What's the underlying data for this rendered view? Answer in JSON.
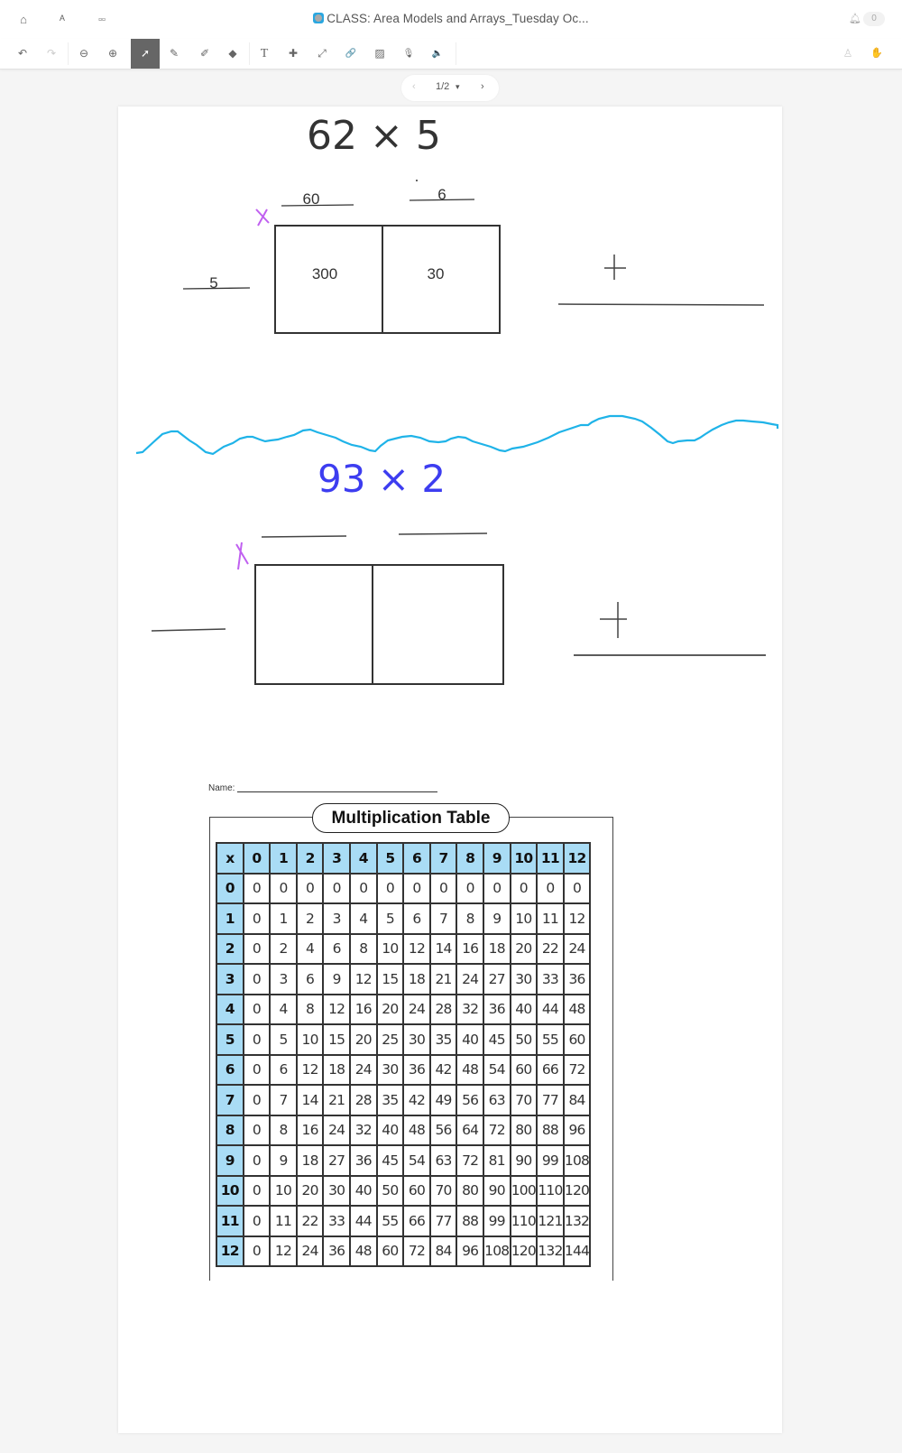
{
  "header": {
    "title": "CLASS: Area Models and Arrays_Tuesday Oc...",
    "notification_count": "0",
    "nav_icons": [
      "home-icon",
      "profile-icon",
      "apps-grid-icon"
    ]
  },
  "toolbar": {
    "undo": "↶",
    "redo": "↷",
    "zoom_out": "⊖",
    "zoom_in": "⊕",
    "select": "➚",
    "pen": "✎",
    "highlighter": "✐",
    "eraser": "◆",
    "text": "T",
    "add": "✚",
    "line": "⤢",
    "link": "🔗",
    "image": "▨",
    "mic": "🎙",
    "audio": "🔈",
    "user": "♙",
    "hand": "✋"
  },
  "pager": {
    "prev": "‹",
    "current": "1/2",
    "dropdown": "▾",
    "next": "›"
  },
  "canvas": {
    "problem1": {
      "expression": "62 × 5",
      "top_labels": [
        "60",
        "6"
      ],
      "side_label": "5",
      "cells": [
        "300",
        "30"
      ],
      "plus": "+",
      "x_mark": "X"
    },
    "problem2": {
      "expression": "93 × 2",
      "top_labels": [
        "",
        ""
      ],
      "side_label": "",
      "cells": [
        "",
        ""
      ],
      "plus": "+",
      "x_mark": "X"
    },
    "colors": {
      "ink": "#222222",
      "marker_purple": "#c060f0",
      "divider_cyan": "#1fb3e8",
      "problem2_ink": "#3d3df0"
    }
  },
  "worksheet": {
    "name_label": "Name:",
    "title": "Multiplication Table",
    "corner": "x",
    "header_color": "#a9dcf5",
    "columns": [
      "0",
      "1",
      "2",
      "3",
      "4",
      "5",
      "6",
      "7",
      "8",
      "9",
      "10",
      "11",
      "12"
    ],
    "rows": [
      {
        "h": "0",
        "v": [
          "0",
          "0",
          "0",
          "0",
          "0",
          "0",
          "0",
          "0",
          "0",
          "0",
          "0",
          "0",
          "0"
        ]
      },
      {
        "h": "1",
        "v": [
          "0",
          "1",
          "2",
          "3",
          "4",
          "5",
          "6",
          "7",
          "8",
          "9",
          "10",
          "11",
          "12"
        ]
      },
      {
        "h": "2",
        "v": [
          "0",
          "2",
          "4",
          "6",
          "8",
          "10",
          "12",
          "14",
          "16",
          "18",
          "20",
          "22",
          "24"
        ]
      },
      {
        "h": "3",
        "v": [
          "0",
          "3",
          "6",
          "9",
          "12",
          "15",
          "18",
          "21",
          "24",
          "27",
          "30",
          "33",
          "36"
        ]
      },
      {
        "h": "4",
        "v": [
          "0",
          "4",
          "8",
          "12",
          "16",
          "20",
          "24",
          "28",
          "32",
          "36",
          "40",
          "44",
          "48"
        ]
      },
      {
        "h": "5",
        "v": [
          "0",
          "5",
          "10",
          "15",
          "20",
          "25",
          "30",
          "35",
          "40",
          "45",
          "50",
          "55",
          "60"
        ]
      },
      {
        "h": "6",
        "v": [
          "0",
          "6",
          "12",
          "18",
          "24",
          "30",
          "36",
          "42",
          "48",
          "54",
          "60",
          "66",
          "72"
        ]
      },
      {
        "h": "7",
        "v": [
          "0",
          "7",
          "14",
          "21",
          "28",
          "35",
          "42",
          "49",
          "56",
          "63",
          "70",
          "77",
          "84"
        ]
      },
      {
        "h": "8",
        "v": [
          "0",
          "8",
          "16",
          "24",
          "32",
          "40",
          "48",
          "56",
          "64",
          "72",
          "80",
          "88",
          "96"
        ]
      },
      {
        "h": "9",
        "v": [
          "0",
          "9",
          "18",
          "27",
          "36",
          "45",
          "54",
          "63",
          "72",
          "81",
          "90",
          "99",
          "108"
        ]
      },
      {
        "h": "10",
        "v": [
          "0",
          "10",
          "20",
          "30",
          "40",
          "50",
          "60",
          "70",
          "80",
          "90",
          "100",
          "110",
          "120"
        ]
      },
      {
        "h": "11",
        "v": [
          "0",
          "11",
          "22",
          "33",
          "44",
          "55",
          "66",
          "77",
          "88",
          "99",
          "110",
          "121",
          "132"
        ]
      },
      {
        "h": "12",
        "v": [
          "0",
          "12",
          "24",
          "36",
          "48",
          "60",
          "72",
          "84",
          "96",
          "108",
          "120",
          "132",
          "144"
        ]
      }
    ]
  }
}
